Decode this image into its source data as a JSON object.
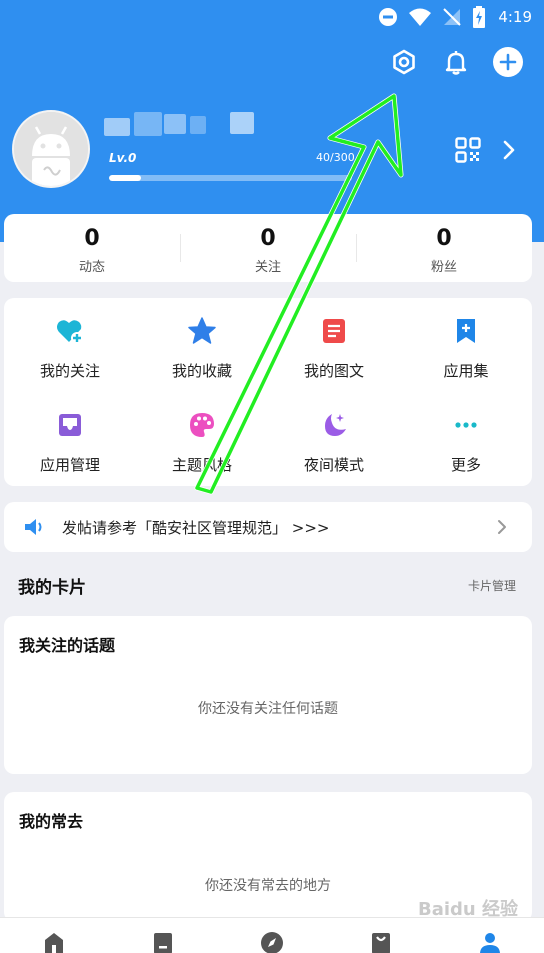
{
  "status_bar": {
    "time": "4:19"
  },
  "profile": {
    "level": "Lv.0",
    "exp": "40/300",
    "exp_fraction": 0.13
  },
  "stats": [
    {
      "value": "0",
      "label": "动态"
    },
    {
      "value": "0",
      "label": "关注"
    },
    {
      "value": "0",
      "label": "粉丝"
    }
  ],
  "grid": [
    {
      "label": "我的关注",
      "icon": "heart-plus-icon"
    },
    {
      "label": "我的收藏",
      "icon": "star-icon"
    },
    {
      "label": "我的图文",
      "icon": "document-icon"
    },
    {
      "label": "应用集",
      "icon": "bookmark-plus-icon"
    },
    {
      "label": "应用管理",
      "icon": "tray-icon"
    },
    {
      "label": "主题风格",
      "icon": "palette-icon"
    },
    {
      "label": "夜间模式",
      "icon": "moon-icon"
    },
    {
      "label": "更多",
      "icon": "more-dots-icon"
    }
  ],
  "notice": {
    "text": "发帖请参考「酷安社区管理规范」 >>>"
  },
  "cards_section": {
    "title": "我的卡片",
    "manage": "卡片管理"
  },
  "topics": {
    "title": "我关注的话题",
    "empty": "你还没有关注任何话题"
  },
  "frequent": {
    "title": "我的常去",
    "empty": "你还没有常去的地方"
  },
  "colors": {
    "header": "#2f8ff0",
    "annotation_arrow": "#22ee22"
  },
  "watermark": "Baidu 经验"
}
